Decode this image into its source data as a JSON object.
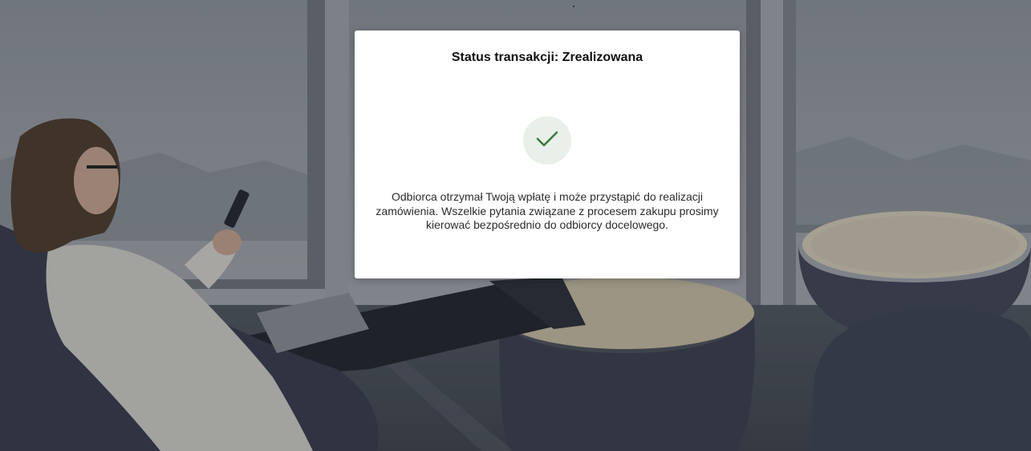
{
  "modal": {
    "title": "Status transakcji: Zrealizowana",
    "icon": "checkmark-icon",
    "icon_color": "#3d7a3f",
    "message": "Odbiorca otrzymał Twoją wpłatę i może przystąpić do realizacji zamówienia. Wszelkie pytania związane z procesem zakupu prosimy kierować bezpośrednio do odbiorcy docelowego."
  },
  "colors": {
    "overlay": "#5c6470",
    "modal_bg": "#ffffff",
    "badge_bg": "#e9efe9"
  }
}
